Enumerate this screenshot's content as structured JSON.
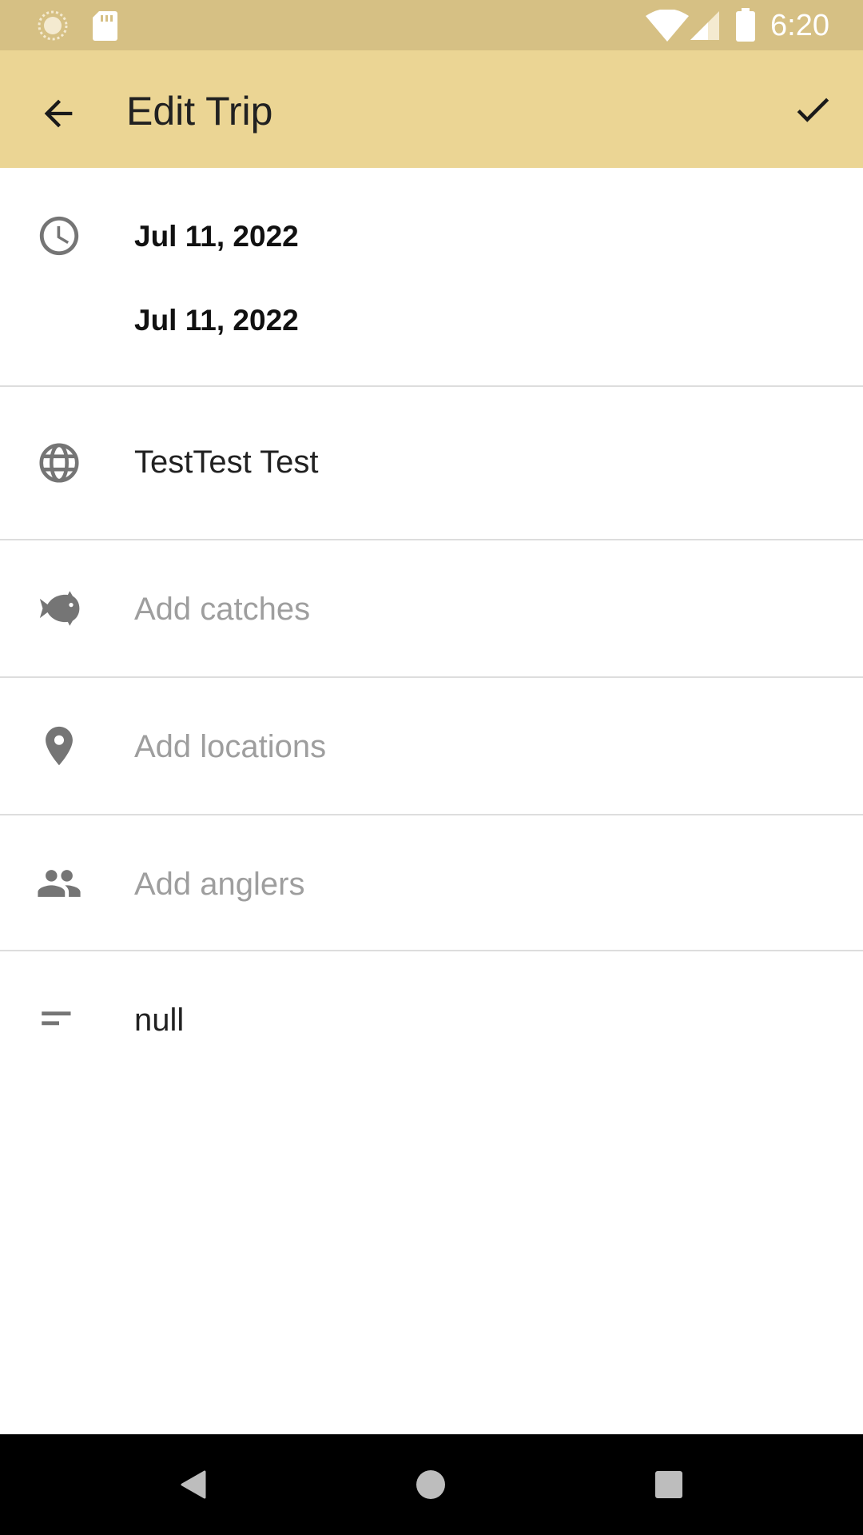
{
  "status_bar": {
    "time": "6:20",
    "icons": [
      "sync-icon",
      "sd-card-icon",
      "wifi-icon",
      "cell-signal-icon",
      "battery-icon"
    ]
  },
  "app_bar": {
    "title": "Edit Trip",
    "back_icon": "arrow-back-icon",
    "save_icon": "check-icon",
    "background": "#ebd594"
  },
  "form": {
    "start_date": "Jul 11, 2022",
    "end_date": "Jul 11, 2022",
    "name": "TestTest Test",
    "catches_placeholder": "Add catches",
    "locations_placeholder": "Add locations",
    "anglers_placeholder": "Add anglers",
    "notes": "null"
  },
  "nav_bar": {
    "icons": [
      "nav-back-icon",
      "nav-home-icon",
      "nav-recents-icon"
    ]
  }
}
